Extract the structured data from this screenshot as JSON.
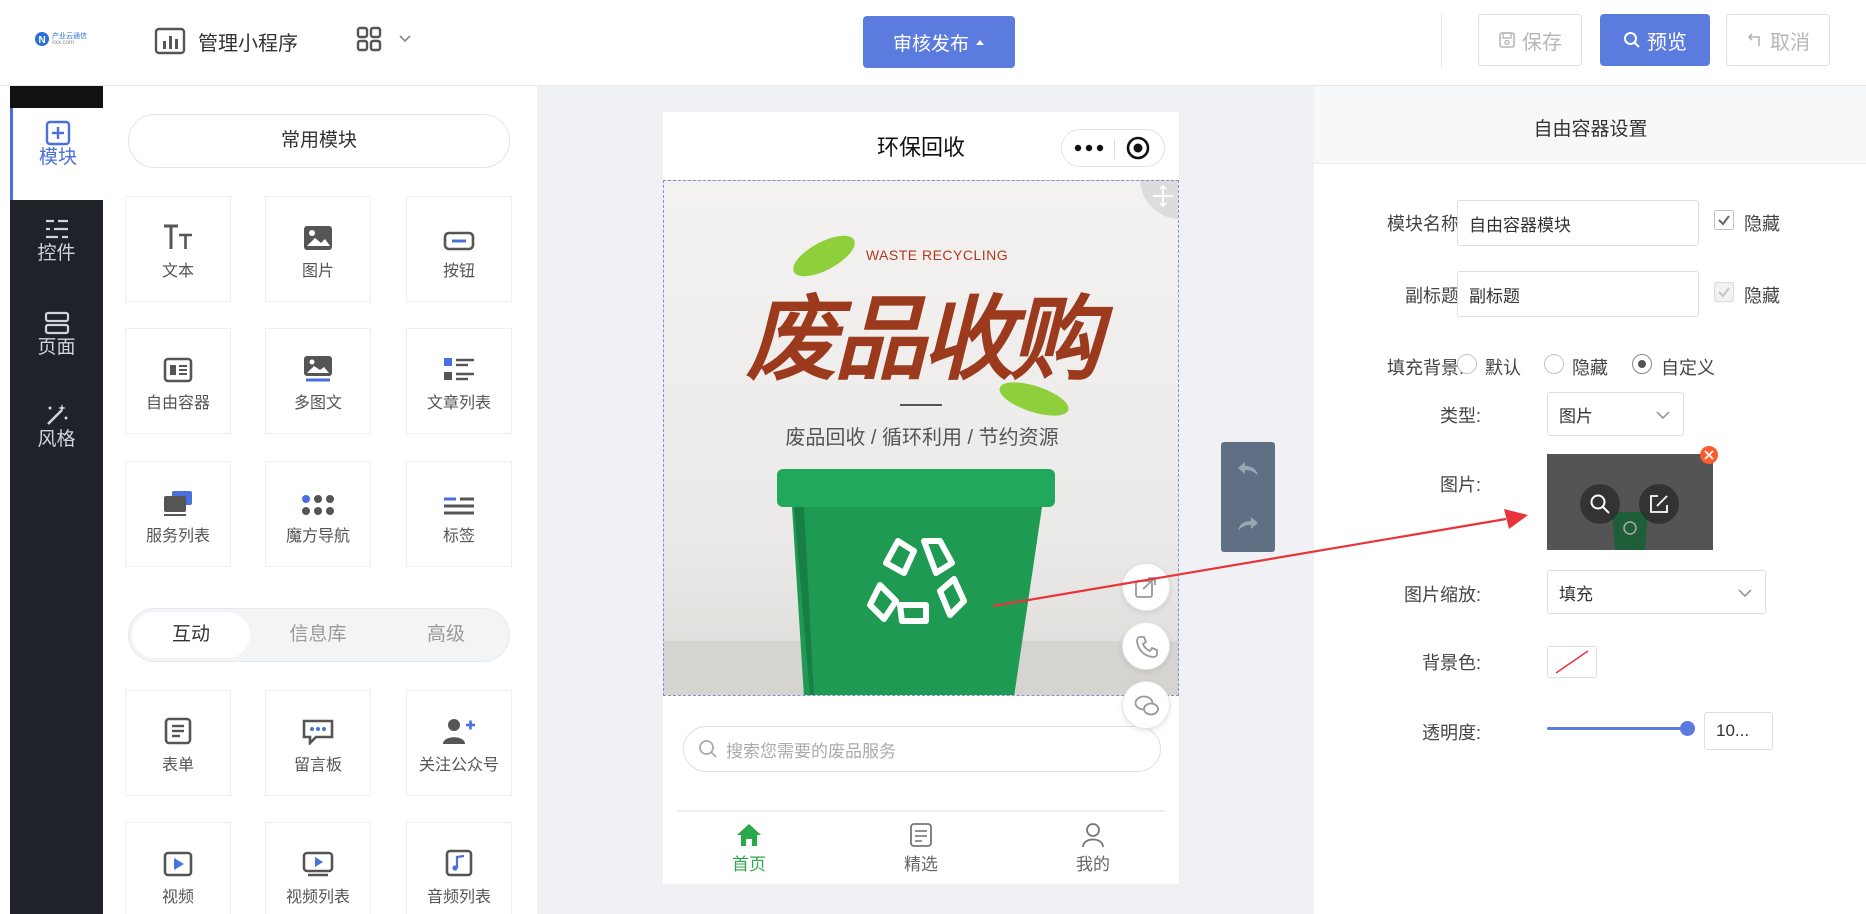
{
  "header": {
    "logo_text": "产业云通信",
    "logo_sub": "xxx.com",
    "manage_label": "管理小程序",
    "publish_label": "审核发布",
    "save_label": "保存",
    "preview_label": "预览",
    "cancel_label": "取消"
  },
  "sidebar": {
    "items": [
      {
        "label": "模块",
        "icon": "plus-square-icon",
        "active": true
      },
      {
        "label": "控件",
        "icon": "sliders-icon",
        "active": false
      },
      {
        "label": "页面",
        "icon": "pages-icon",
        "active": false
      },
      {
        "label": "风格",
        "icon": "magic-wand-icon",
        "active": false
      }
    ]
  },
  "modules": {
    "common_label": "常用模块",
    "common": [
      "文本",
      "图片",
      "按钮",
      "自由容器",
      "多图文",
      "文章列表",
      "服务列表",
      "魔方导航",
      "标签"
    ],
    "tabs": [
      "互动",
      "信息库",
      "高级"
    ],
    "interactive": [
      "表单",
      "留言板",
      "关注公众号",
      "视频",
      "视频列表",
      "音频列表"
    ]
  },
  "phone": {
    "title": "环保回收",
    "banner_en": "WASTE RECYCLING",
    "banner_title": "废品收购",
    "banner_sub": "废品回收 / 循环利用 / 节约资源",
    "search_placeholder": "搜索您需要的废品服务",
    "tabs": [
      "首页",
      "精选",
      "我的"
    ]
  },
  "settings": {
    "panel_title": "自由容器设置",
    "name_label": "模块名称:",
    "name_value": "自由容器模块",
    "hide_label": "隐藏",
    "subtitle_label": "副标题:",
    "subtitle_value": "副标题",
    "fill_bg_label": "填充背景:",
    "fill_options": [
      "默认",
      "隐藏",
      "自定义"
    ],
    "type_label": "类型:",
    "type_value": "图片",
    "image_label": "图片:",
    "scale_label": "图片缩放:",
    "scale_value": "填充",
    "bgcolor_label": "背景色:",
    "opacity_label": "透明度:",
    "opacity_value": "10...",
    "opacity_level": 1.0
  },
  "colors": {
    "accent": "#5b7bde",
    "sidebar_bg": "#1f2228",
    "green": "#2aa84a",
    "arrow_red": "#e8333a"
  }
}
